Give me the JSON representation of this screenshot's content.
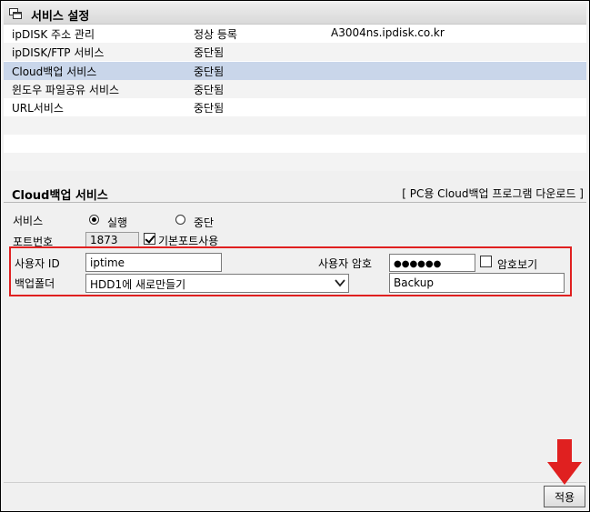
{
  "header": {
    "title": "서비스 설정",
    "icon": "windows-icon"
  },
  "services": [
    {
      "name": "ipDISK 주소 관리",
      "status": "정상 등록",
      "extra": "A3004ns.ipdisk.co.kr"
    },
    {
      "name": "ipDISK/FTP 서비스",
      "status": "중단됨",
      "extra": ""
    },
    {
      "name": "Cloud백업 서비스",
      "status": "중단됨",
      "extra": ""
    },
    {
      "name": "윈도우 파일공유 서비스",
      "status": "중단됨",
      "extra": ""
    },
    {
      "name": "URL서비스",
      "status": "중단됨",
      "extra": ""
    }
  ],
  "selected_service_index": 2,
  "section": {
    "title": "Cloud백업 서비스",
    "download_link": "[ PC용 Cloud백업 프로그램 다운로드 ]"
  },
  "form": {
    "service_label": "서비스",
    "run_label": "실행",
    "stop_label": "중단",
    "service_state": "run",
    "port_label": "포트번호",
    "port_value": "1873",
    "default_port_label": "기본포트사용",
    "default_port_checked": true,
    "user_id_label": "사용자 ID",
    "user_id_value": "iptime",
    "password_label": "사용자 암호",
    "password_value": "●●●●●●",
    "show_password_label": "암호보기",
    "show_password_checked": false,
    "backup_folder_label": "백업폴더",
    "backup_folder_selected": "HDD1에 새로만들기",
    "backup_folder_name": "Backup"
  },
  "apply_label": "적용",
  "colors": {
    "selected_row": "#c9d6ea",
    "highlight_border": "#e02020",
    "arrow": "#e02020"
  }
}
